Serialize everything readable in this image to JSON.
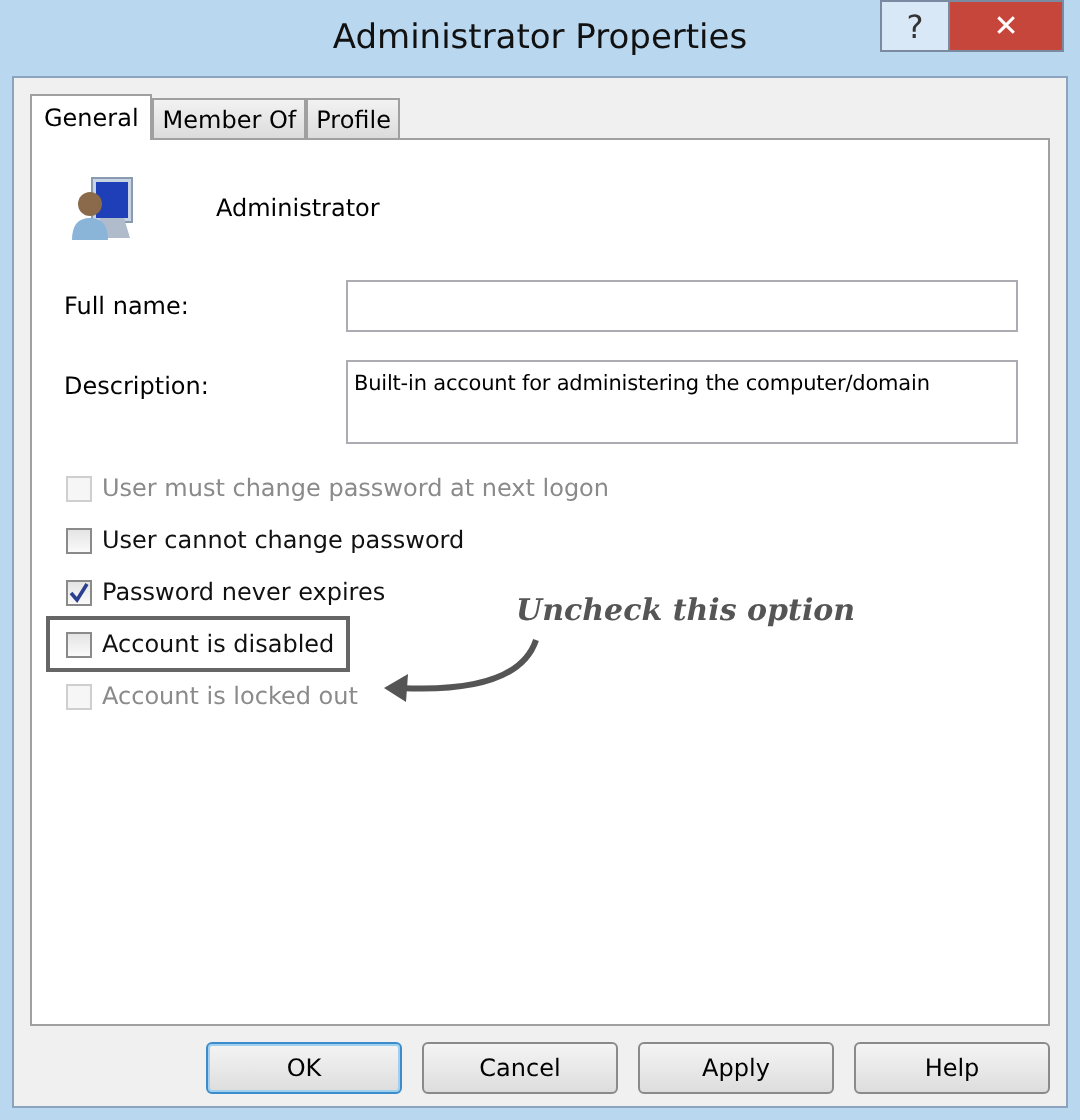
{
  "window": {
    "title": "Administrator Properties",
    "help_button": "?",
    "close_button": "✕"
  },
  "tabs": [
    {
      "label": "General",
      "selected": true
    },
    {
      "label": "Member Of",
      "selected": false
    },
    {
      "label": "Profile",
      "selected": false
    }
  ],
  "user": {
    "name": "Administrator"
  },
  "fields": [
    {
      "kind": "line",
      "label": "Full name:"
    },
    {
      "kind": "multiline",
      "label": "Description:",
      "value": "Built-in account for administering the computer/domain"
    }
  ],
  "options": [
    {
      "label": "User must change password at next logon",
      "checked": false,
      "disabled": true,
      "highlighted": false
    },
    {
      "label": "User cannot change password",
      "checked": false,
      "disabled": false,
      "highlighted": false
    },
    {
      "label": "Password never expires",
      "checked": true,
      "disabled": false,
      "highlighted": false
    },
    {
      "label": "Account is disabled",
      "checked": false,
      "disabled": false,
      "highlighted": true
    },
    {
      "label": "Account is locked out",
      "checked": false,
      "disabled": true,
      "highlighted": false
    }
  ],
  "annotation": {
    "text": "Uncheck this option"
  },
  "buttons": [
    {
      "label": "OK",
      "default": true
    },
    {
      "label": "Cancel",
      "default": false
    },
    {
      "label": "Apply",
      "default": false
    },
    {
      "label": "Help",
      "default": false
    }
  ]
}
